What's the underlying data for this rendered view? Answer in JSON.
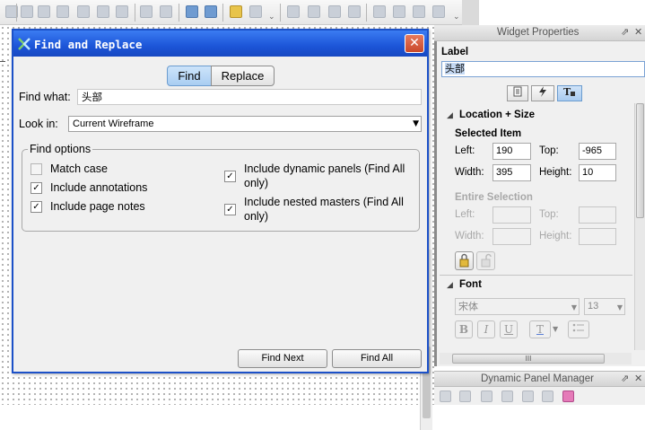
{
  "dialog": {
    "title": "Find and Replace",
    "close_glyph": "✕",
    "tabs": [
      {
        "label": "Find",
        "selected": true
      },
      {
        "label": "Replace",
        "selected": false
      }
    ],
    "find_what_label": "Find what:",
    "find_what_value": "头部",
    "look_in_label": "Look in:",
    "look_in_value": "Current Wireframe",
    "find_options_label": "Find options",
    "options": {
      "match_case": {
        "label": "Match case",
        "checked": false
      },
      "include_annotations": {
        "label": "Include annotations",
        "checked": true
      },
      "include_page_notes": {
        "label": "Include page notes",
        "checked": true
      },
      "include_dynamic_panels": {
        "label": "Include dynamic panels (Find All only)",
        "checked": true
      },
      "include_nested_masters": {
        "label": "Include nested masters (Find All only)",
        "checked": true
      }
    },
    "find_next_label": "Find Next",
    "find_all_label": "Find All"
  },
  "widget_properties": {
    "title": "Widget Properties",
    "label_heading": "Label",
    "label_value": "头部",
    "section_location": "Location + Size",
    "selected_item": "Selected Item",
    "left_label": "Left:",
    "left_value": "190",
    "top_label": "Top:",
    "top_value": "-965",
    "width_label": "Width:",
    "width_value": "395",
    "height_label": "Height:",
    "height_value": "10",
    "entire_selection": "Entire Selection",
    "section_font": "Font",
    "font_family": "宋体",
    "font_size": "13",
    "bold_glyph": "B",
    "italic_glyph": "I",
    "underline_glyph": "U",
    "color_glyph": "T",
    "scroll_grip": "III"
  },
  "dynamic_panel_manager": {
    "title": "Dynamic Panel Manager"
  },
  "icons": {
    "checkmark": "✓",
    "pin": "⇗",
    "close": "✕",
    "dropdown": "▼",
    "collapse": "◢"
  },
  "colors": {
    "dialog_title": "#1c55d8",
    "find_tab": "#a9cdf2",
    "close_button": "#c9482a"
  }
}
